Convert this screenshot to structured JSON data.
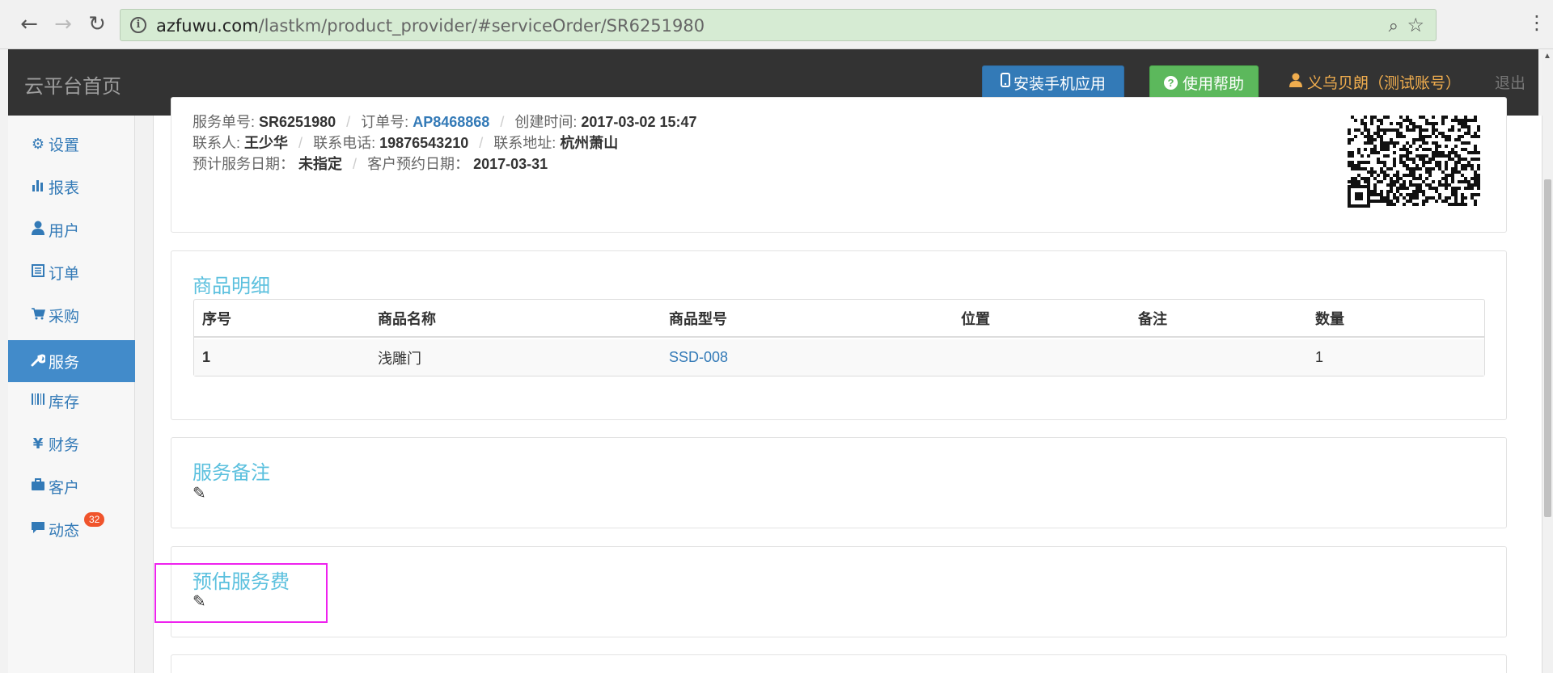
{
  "browser": {
    "url_domain": "azfuwu.com",
    "url_path": "/lastkm/product_provider/#serviceOrder/SR6251980"
  },
  "navbar": {
    "brand": "云平台首页",
    "install_app": "安装手机应用",
    "help": "使用帮助",
    "user": "义乌贝朗（测试账号）",
    "logout": "退出"
  },
  "sidebar": {
    "items": [
      {
        "label": "设置",
        "icon": "gear-icon",
        "glyph": "⚙"
      },
      {
        "label": "报表",
        "icon": "bar-chart-icon",
        "glyph": "▮"
      },
      {
        "label": "用户",
        "icon": "user-icon",
        "glyph": "👤"
      },
      {
        "label": "订单",
        "icon": "list-icon",
        "glyph": "☰"
      },
      {
        "label": "采购",
        "icon": "cart-icon",
        "glyph": "🛒"
      },
      {
        "label": "服务",
        "icon": "wrench-icon",
        "glyph": "🔧"
      },
      {
        "label": "库存",
        "icon": "barcode-icon",
        "glyph": "‖"
      },
      {
        "label": "财务",
        "icon": "yen-icon",
        "glyph": "¥"
      },
      {
        "label": "客户",
        "icon": "briefcase-icon",
        "glyph": "💼"
      },
      {
        "label": "动态",
        "icon": "comment-icon",
        "glyph": "💬"
      }
    ],
    "badge": "32",
    "active_index": 5
  },
  "order": {
    "service_no_label": "服务单号:",
    "service_no": "SR6251980",
    "order_no_label": "订单号:",
    "order_no": "AP8468868",
    "created_label": "创建时间:",
    "created": "2017-03-02 15:47",
    "contact_label": "联系人:",
    "contact": "王少华",
    "phone_label": "联系电话:",
    "phone": "19876543210",
    "address_label": "联系地址:",
    "address": "杭州萧山",
    "planned_date_label": "预计服务日期：",
    "planned_date": "未指定",
    "booking_date_label": "客户预约日期：",
    "booking_date": "2017-03-31"
  },
  "products": {
    "title": "商品明细",
    "headers": [
      "序号",
      "商品名称",
      "商品型号",
      "位置",
      "备注",
      "数量"
    ],
    "rows": [
      {
        "no": "1",
        "name": "浅雕门",
        "model": "SSD-008",
        "location": "",
        "note": "",
        "qty": "1"
      }
    ]
  },
  "service_note": {
    "title": "服务备注"
  },
  "estimated_fee": {
    "title": "预估服务费"
  }
}
